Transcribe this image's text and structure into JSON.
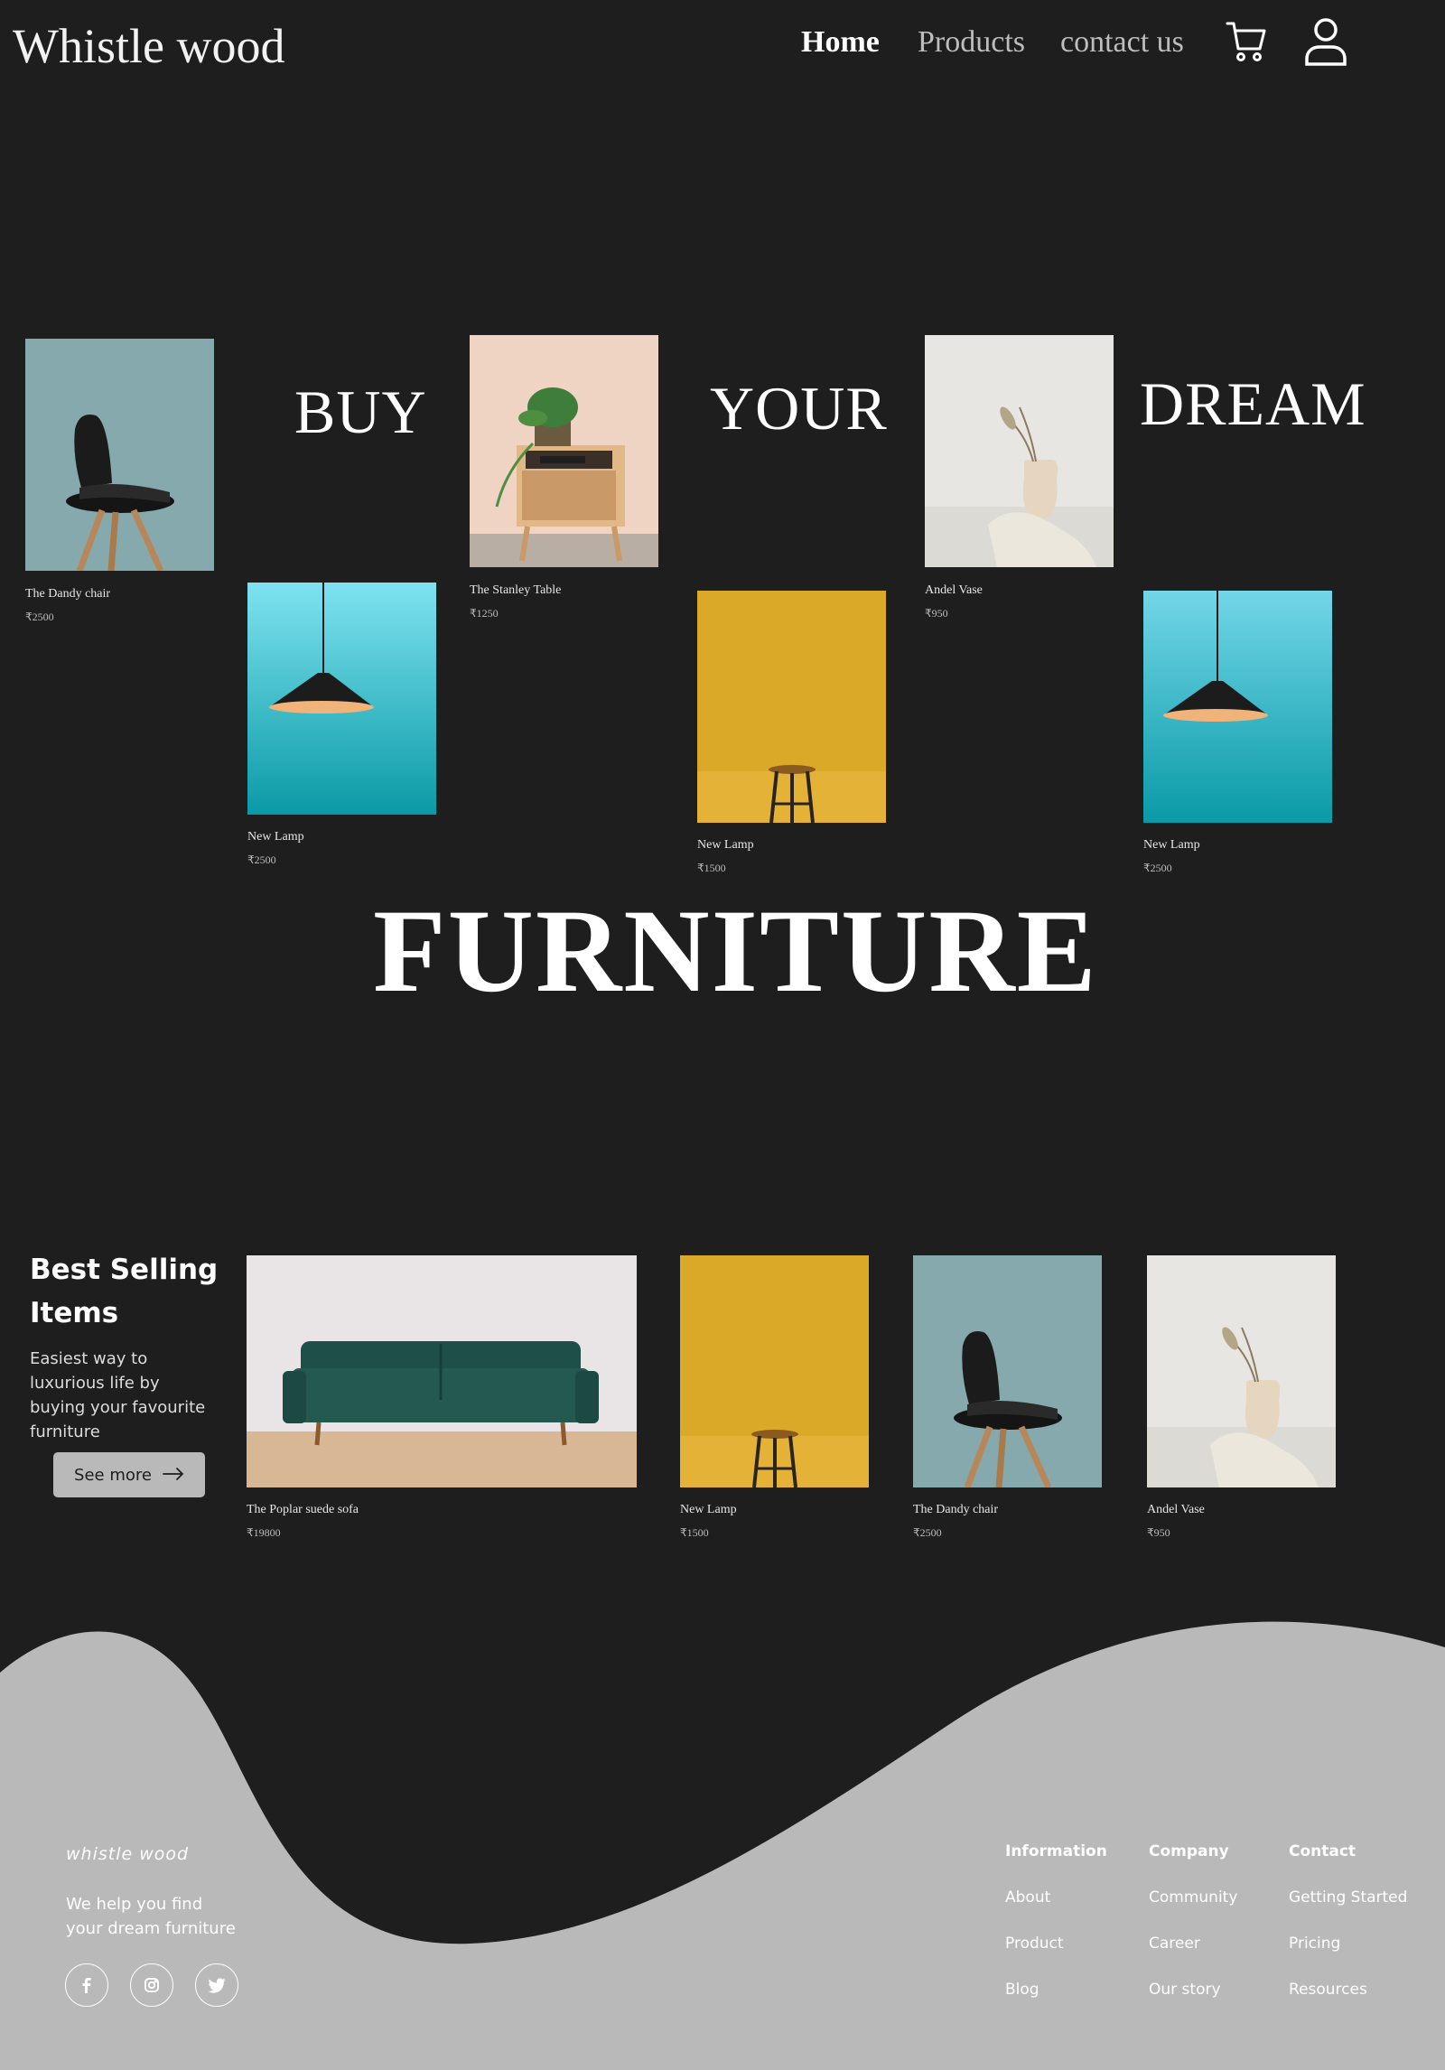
{
  "header": {
    "logo": "Whistle wood",
    "nav": [
      {
        "label": "Home",
        "active": true
      },
      {
        "label": "Products",
        "active": false
      },
      {
        "label": "contact us",
        "active": false
      }
    ],
    "icons": [
      "cart-icon",
      "user-icon"
    ]
  },
  "hero": {
    "words": [
      "BUY",
      "YOUR",
      "DREAM"
    ],
    "headline": "FURNITURE",
    "products": [
      {
        "name": "The Dandy chair",
        "price": "₹2500"
      },
      {
        "name": "New Lamp",
        "price": "₹2500"
      },
      {
        "name": "The Stanley Table",
        "price": "₹1250"
      },
      {
        "name": "New Lamp",
        "price": "₹1500"
      },
      {
        "name": "Andel Vase",
        "price": "₹950"
      },
      {
        "name": "New Lamp",
        "price": "₹2500"
      }
    ]
  },
  "best_selling": {
    "title_line1": "Best Selling",
    "title_line2": "Items",
    "desc_lines": [
      "Easiest way to",
      "luxurious life by",
      "buying your favourite",
      "furniture"
    ],
    "button": "See more",
    "products": [
      {
        "name": "The Poplar suede sofa",
        "price": "₹19800"
      },
      {
        "name": "New Lamp",
        "price": "₹1500"
      },
      {
        "name": "The Dandy chair",
        "price": "₹2500"
      },
      {
        "name": "Andel Vase",
        "price": "₹950"
      }
    ]
  },
  "footer": {
    "brand": "whistle wood",
    "tagline_line1": "We help you find",
    "tagline_line2": "your dream furniture",
    "social": [
      "facebook-icon",
      "instagram-icon",
      "twitter-icon"
    ],
    "columns": [
      {
        "heading": "Information",
        "links": [
          "About",
          "Product",
          "Blog"
        ]
      },
      {
        "heading": "Company",
        "links": [
          "Community",
          "Career",
          "Our story"
        ]
      },
      {
        "heading": "Contact",
        "links": [
          "Getting Started",
          "Pricing",
          "Resources"
        ]
      }
    ]
  },
  "colors": {
    "background": "#1e1e1e",
    "footer": "#b9b9b9",
    "chair_bg": "#86a9ad",
    "lamp_bg": "#2fb8cc",
    "stool_bg": "#dba928",
    "table_bg": "#efd3c3",
    "vase_bg": "#e8e6e2",
    "sofa_green": "#1f5047"
  }
}
